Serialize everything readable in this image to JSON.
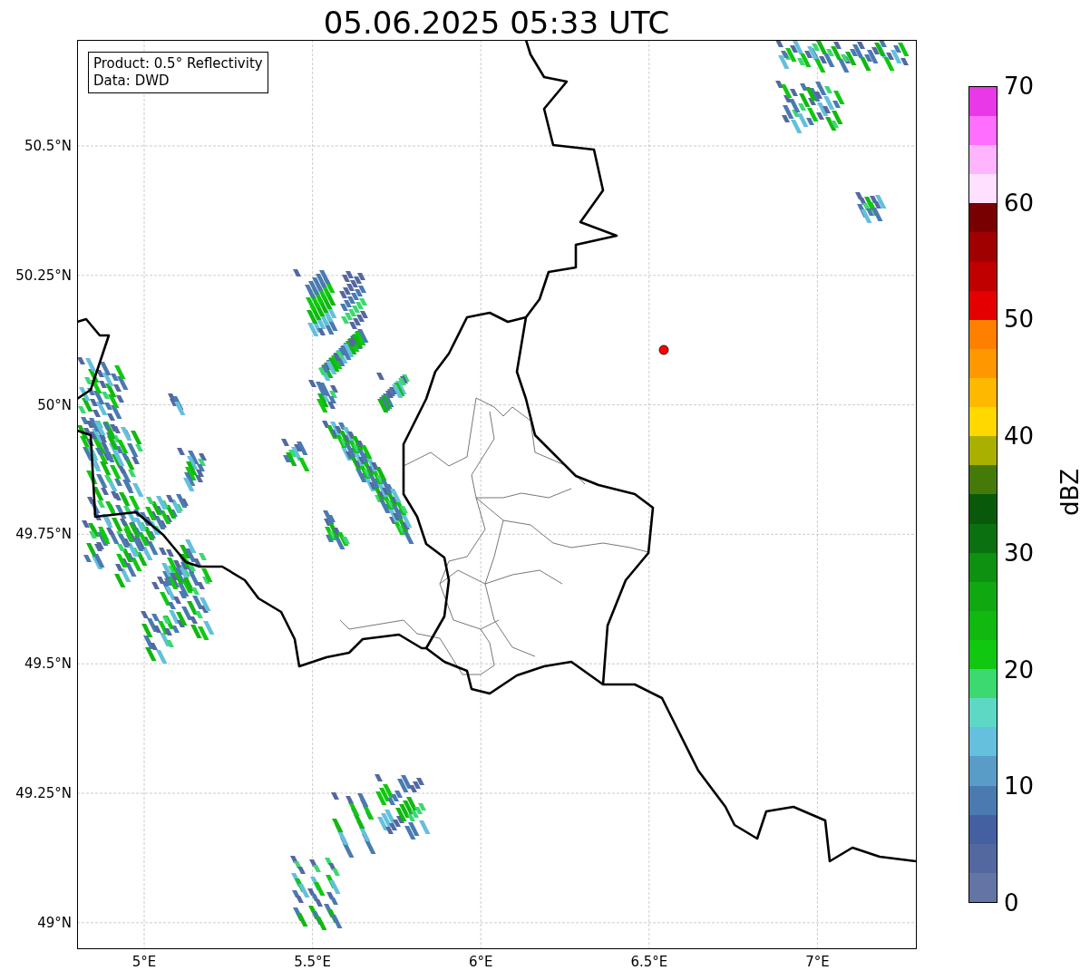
{
  "title": "05.06.2025 05:33 UTC",
  "legend": [
    "Product: 0.5° Reflectivity",
    "Data: DWD"
  ],
  "map": {
    "yticks": [
      "50.5°N",
      "50.25°N",
      "50°N",
      "49.75°N",
      "49.5°N",
      "49.25°N",
      "49°N"
    ],
    "xticks": [
      "5°E",
      "5.5°E",
      "6°E",
      "6.5°E",
      "7°E"
    ]
  },
  "colorbar": {
    "label": "dBZ",
    "ticks": [
      "70",
      "60",
      "50",
      "40",
      "30",
      "20",
      "10",
      "0"
    ],
    "bands": [
      {
        "color": "#6474a4"
      },
      {
        "color": "#5468a0"
      },
      {
        "color": "#4460a0"
      },
      {
        "color": "#4a7ab0"
      },
      {
        "color": "#5a9cc8"
      },
      {
        "color": "#64c0dc"
      },
      {
        "color": "#5cd8c4"
      },
      {
        "color": "#3cd870"
      },
      {
        "color": "#10c810"
      },
      {
        "color": "#10b810"
      },
      {
        "color": "#10a810"
      },
      {
        "color": "#0e9010"
      },
      {
        "color": "#0a7010"
      },
      {
        "color": "#085a0a"
      },
      {
        "color": "#467a08"
      },
      {
        "color": "#aab000"
      },
      {
        "color": "#ffd800"
      },
      {
        "color": "#ffb800"
      },
      {
        "color": "#ff9800"
      },
      {
        "color": "#ff8000"
      },
      {
        "color": "#e40000"
      },
      {
        "color": "#c00000"
      },
      {
        "color": "#a00000"
      },
      {
        "color": "#780000"
      },
      {
        "color": "#ffe0ff"
      },
      {
        "color": "#ffb4ff"
      },
      {
        "color": "#ff6eff"
      },
      {
        "color": "#e838e8"
      }
    ]
  }
}
